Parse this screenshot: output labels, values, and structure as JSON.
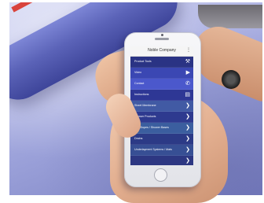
{
  "app": {
    "title": "Noble Company",
    "menu_icon": "more-vertical-icon"
  },
  "menu": [
    {
      "label": "Product Tools",
      "icon": "tools-icon",
      "glyph": "⚒",
      "color": "#2a3384"
    },
    {
      "label": "Video",
      "icon": "play-icon",
      "glyph": "▶",
      "color": "#3b47b3"
    },
    {
      "label": "Contact",
      "icon": "phone-icon",
      "glyph": "✆",
      "color": "#4b58cc"
    },
    {
      "label": "Instructions",
      "icon": "document-icon",
      "glyph": "▤",
      "color": "#2e3795"
    },
    {
      "label": "Sheet Membrane",
      "icon": "chevron-right-icon",
      "glyph": "❯",
      "color": "#415aa4"
    },
    {
      "label": "Shower Products",
      "icon": "chevron-right-icon",
      "glyph": "❯",
      "color": "#2e3a8f"
    },
    {
      "label": "Pre-Slopes / Shower Bases",
      "icon": "chevron-right-icon",
      "glyph": "❯",
      "color": "#3b5e9f"
    },
    {
      "label": "Drains",
      "icon": "chevron-right-icon",
      "glyph": "❯",
      "color": "#2c3a86"
    },
    {
      "label": "Underlayment Systems / Mats",
      "icon": "chevron-right-icon",
      "glyph": "❯",
      "color": "#374f94"
    },
    {
      "label": "",
      "icon": "chevron-right-icon",
      "glyph": "❯",
      "color": "#2d3782"
    }
  ]
}
